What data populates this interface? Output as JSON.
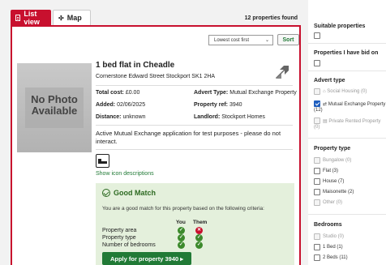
{
  "tabs": {
    "list": "List view",
    "map": "Map"
  },
  "results": {
    "count": "12 properties found"
  },
  "sort": {
    "selected": "Lowest cost first",
    "button": "Sort"
  },
  "property": {
    "photo_text_1": "No Photo",
    "photo_text_2": "Available",
    "title": "1 bed flat in Cheadle",
    "address": "Cornerstone Edward Street Stockport SK1 2HA",
    "total_cost_label": "Total cost:",
    "total_cost": "£0.00",
    "added_label": "Added:",
    "added": "02/06/2025",
    "distance_label": "Distance:",
    "distance": "unknown",
    "advert_type_label": "Advert Type:",
    "advert_type": "Mutual Exchange Property",
    "ref_label": "Property ref:",
    "ref": "3940",
    "landlord_label": "Landlord:",
    "landlord": "Stockport Homes",
    "note": "Active Mutual Exchange application for test purposes - please do not interact.",
    "show_icons": "Show icon descriptions"
  },
  "match": {
    "title": "Good Match",
    "text": "You are a good match for this property based on the following criteria:",
    "col_you": "You",
    "col_them": "Them",
    "criteria": [
      {
        "label": "Property area",
        "you": "ok",
        "them": "no"
      },
      {
        "label": "Property type",
        "you": "ok",
        "them": "ok"
      },
      {
        "label": "Number of bedrooms",
        "you": "ok",
        "them": "ok"
      }
    ],
    "apply": "Apply for property 3940 ▸"
  },
  "sidebar": {
    "suitable": "Suitable properties",
    "bid_on": "Properties I have bid on",
    "advert_type": "Advert type",
    "advert_options": [
      "Social Housing (0)",
      "Mutual Exchange Property",
      "(12)",
      "Private Rented Property",
      "(0)"
    ],
    "property_type": "Property type",
    "type_options": [
      "Bungalow (0)",
      "Flat (3)",
      "House (7)",
      "Maisonette (2)",
      "Other (0)"
    ],
    "bedrooms": "Bedrooms",
    "bed_options": [
      "Studio (0)",
      "1 Bed (1)",
      "2 Beds (11)"
    ]
  }
}
